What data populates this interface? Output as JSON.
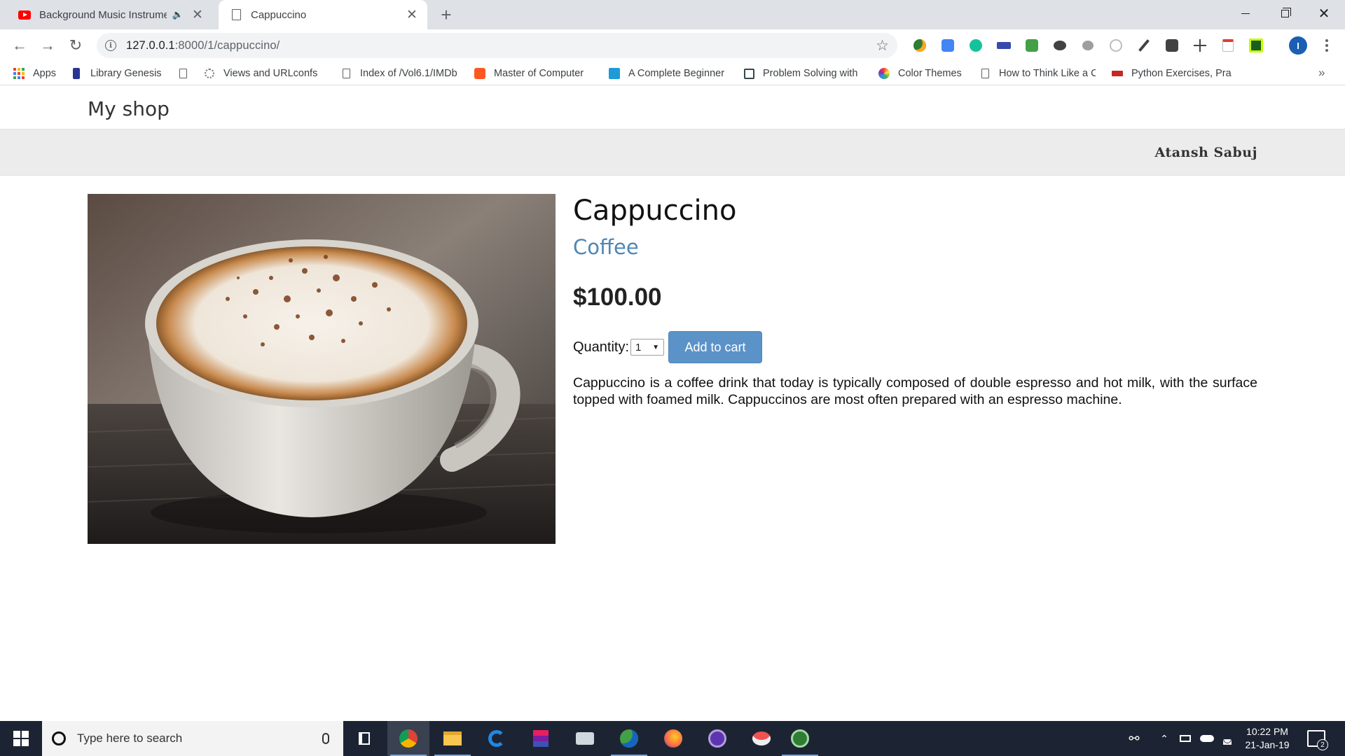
{
  "browser": {
    "tabs": [
      {
        "title": "Background Music Instrumental",
        "favicon": "youtube-icon",
        "audio": true,
        "active": false
      },
      {
        "title": "Cappuccino",
        "favicon": "document-icon",
        "audio": false,
        "active": true
      }
    ],
    "url": {
      "host": "127.0.0.1",
      "path": ":8000/1/cappuccino/"
    },
    "profile_initial": "I",
    "bookmarks": [
      {
        "label": "Apps",
        "icon": "apps-grid-icon"
      },
      {
        "label": "Library Genesis",
        "icon": "library-icon"
      },
      {
        "label": "",
        "icon": "document-icon"
      },
      {
        "label": "Views and URLconfs",
        "icon": "django-icon"
      },
      {
        "label": "Index of /Vol6.1/IMDb",
        "icon": "document-icon"
      },
      {
        "label": "Master of Computer",
        "icon": "blogger-icon"
      },
      {
        "label": "A Complete Beginner",
        "icon": "s-icon"
      },
      {
        "label": "Problem Solving with",
        "icon": "book-icon"
      },
      {
        "label": "Color Themes",
        "icon": "color-wheel-icon"
      },
      {
        "label": "How to Think Like a C",
        "icon": "document-icon"
      },
      {
        "label": "Python Exercises, Pra",
        "icon": "w3resource-icon"
      }
    ]
  },
  "site": {
    "brand": "My shop",
    "user": "Atansh Sabuj"
  },
  "product": {
    "name": "Cappuccino",
    "category": "Coffee",
    "price": "$100.00",
    "quantity_label": "Quantity:",
    "quantity_value": "1",
    "add_to_cart_label": "Add to cart",
    "description": "Cappuccino is a coffee drink that today is typically composed of double espresso and hot milk, with the surface topped with foamed milk. Cappuccinos are most often prepared with an espresso machine.",
    "image_alt": "cup of cappuccino"
  },
  "taskbar": {
    "search_placeholder": "Type here to search",
    "time": "10:22 PM",
    "date": "21-Jan-19",
    "notification_count": "2"
  },
  "colors": {
    "accent_button": "#5b93c8",
    "category_link": "#4f86b5",
    "subbar": "#ececec",
    "taskbar": "#1c2433"
  }
}
